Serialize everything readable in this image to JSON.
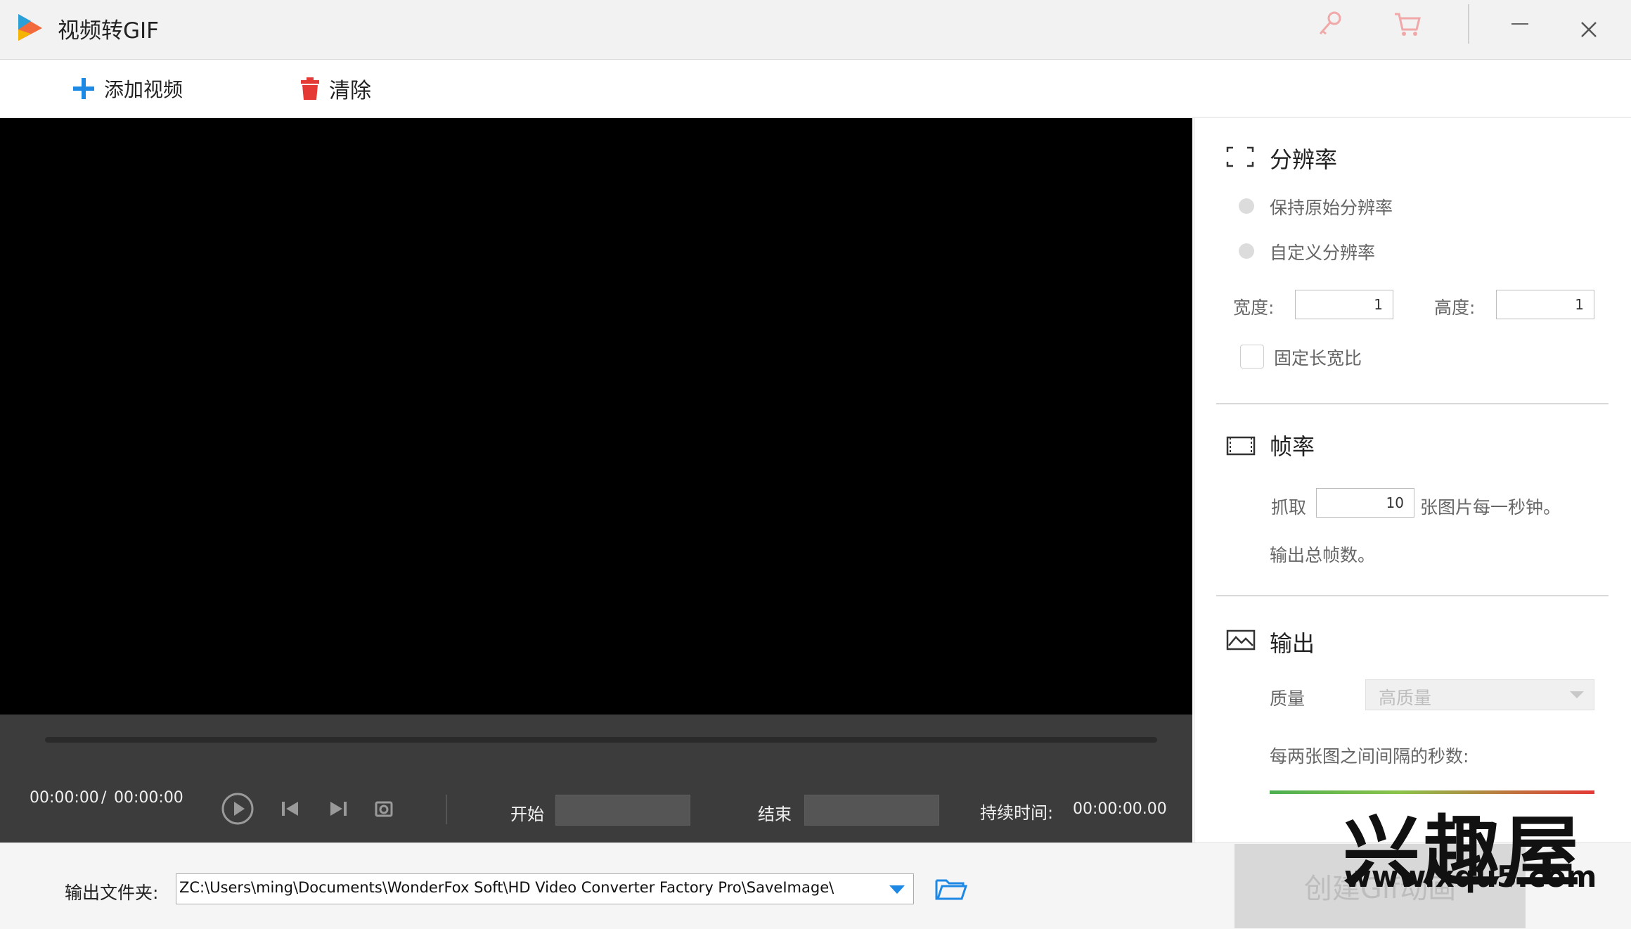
{
  "titlebar": {
    "title": "视频转GIF",
    "icons": [
      "key-icon",
      "cart-icon",
      "minimize-icon",
      "close-icon"
    ],
    "accent_icon_color": "#f0a8a8"
  },
  "toolbar": {
    "add_label": "添加视频",
    "clear_label": "清除",
    "add_icon_color": "#1e88e5",
    "clear_icon_color": "#e53935"
  },
  "player": {
    "current_time": "00:00:00",
    "separator": "/",
    "total_time": "00:00:00",
    "start_label": "开始",
    "end_label": "结束",
    "duration_label": "持续时间:",
    "duration_value": "00:00:00.00"
  },
  "resolution": {
    "title": "分辨率",
    "option_keep": "保持原始分辨率",
    "option_custom": "自定义分辨率",
    "width_label": "宽度:",
    "width_value": "1",
    "height_label": "高度:",
    "height_value": "1",
    "lock_ratio_label": "固定长宽比"
  },
  "framerate": {
    "title": "帧率",
    "capture_label": "抓取",
    "capture_value": "10",
    "capture_suffix": "张图片每一秒钟。",
    "total_frames_label": "输出总帧数。"
  },
  "output": {
    "title": "输出",
    "quality_label": "质量",
    "quality_value": "高质量",
    "interval_label": "每两张图之间间隔的秒数:"
  },
  "bottom": {
    "folder_label": "输出文件夹:",
    "folder_path": "ZC:\\Users\\ming\\Documents\\WonderFox Soft\\HD Video Converter Factory Pro\\SaveImage\\",
    "create_label": "创建Gif动画"
  },
  "watermark": {
    "main": "兴趣屋",
    "url": "www.xqu5.com"
  }
}
